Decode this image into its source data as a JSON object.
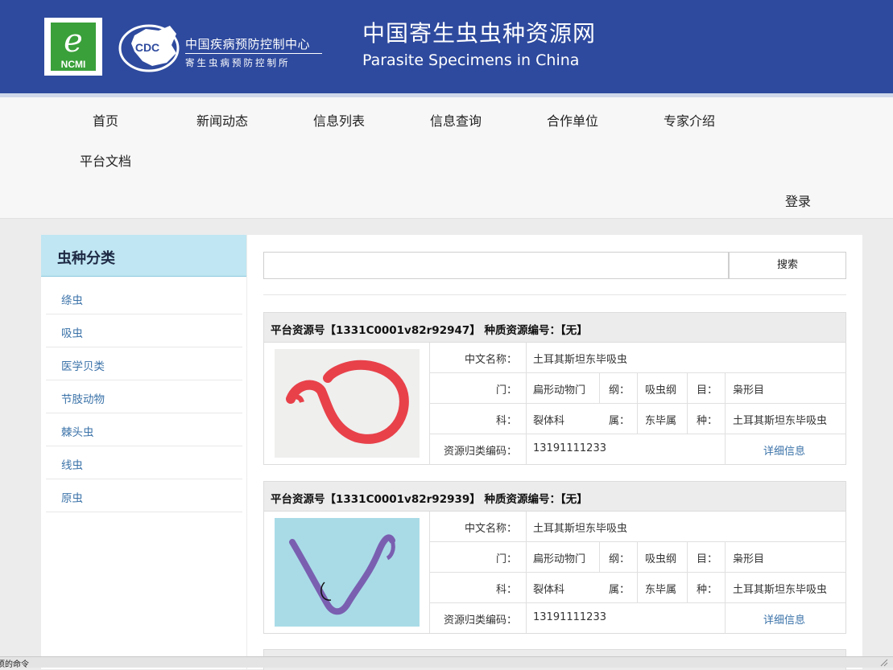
{
  "header": {
    "ncmi_logo_text": "NCMI",
    "cdc_logo_text": "CDC",
    "cdc_name_cn": "中国疾病预防控制中心",
    "cdc_institute_cn": "寄生虫病预防控制所",
    "site_title_cn": "中国寄生虫虫种资源网",
    "site_title_en": "Parasite Specimens in China"
  },
  "nav": {
    "items": [
      "首页",
      "新闻动态",
      "信息列表",
      "信息查询",
      "合作单位",
      "专家介绍",
      "平台文档"
    ],
    "login": "登录"
  },
  "sidebar": {
    "title": "虫种分类",
    "items": [
      "绦虫",
      "吸虫",
      "医学贝类",
      "节肢动物",
      "棘头虫",
      "线虫",
      "原虫"
    ]
  },
  "search": {
    "input_value": "",
    "button_label": "搜索"
  },
  "labels": {
    "cn_name": "中文名称：",
    "phylum": "门：",
    "class": "纲：",
    "order": "目：",
    "family": "科：",
    "genus": "属：",
    "species": "种：",
    "code": "资源归类编码：",
    "detail": "详细信息"
  },
  "records": [
    {
      "header": "平台资源号【1331C0001v82r92947】 种质资源编号：【无】",
      "cn_name": "土耳其斯坦东毕吸虫",
      "phylum": "扁形动物门",
      "class": "吸虫纲",
      "order": "枭形目",
      "family": "裂体科",
      "genus": "东毕属",
      "species": "土耳其斯坦东毕吸虫",
      "code": "13191111233",
      "image_color": "#e8414a"
    },
    {
      "header": "平台资源号【1331C0001v82r92939】 种质资源编号：【无】",
      "cn_name": "土耳其斯坦东毕吸虫",
      "phylum": "扁形动物门",
      "class": "吸虫纲",
      "order": "枭形目",
      "family": "裂体科",
      "genus": "东毕属",
      "species": "土耳其斯坦东毕吸虫",
      "code": "13191111233",
      "image_color": "#7a5fb0"
    }
  ],
  "statusbar": {
    "text": "选项的命令"
  },
  "colors": {
    "header_bg": "#2e4a9e",
    "sidebar_head_bg": "#bfe6f2",
    "link": "#3a72a8"
  }
}
